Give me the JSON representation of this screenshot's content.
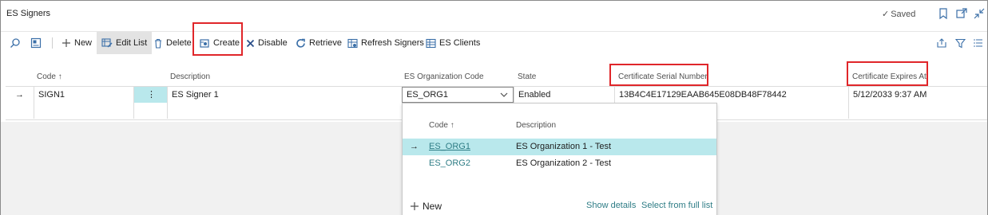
{
  "window": {
    "title": "ES Signers",
    "status": "Saved"
  },
  "actions": {
    "new": "New",
    "edit_list": "Edit List",
    "delete": "Delete",
    "create": "Create",
    "disable": "Disable",
    "retrieve": "Retrieve",
    "refresh_signers": "Refresh Signers",
    "es_clients": "ES Clients"
  },
  "table": {
    "columns": {
      "code": "Code",
      "sort_arrow": "↑",
      "description": "Description",
      "org_code": "ES Organization Code",
      "state": "State",
      "serial": "Certificate Serial Number",
      "expires": "Certificate Expires At"
    },
    "rows": [
      {
        "marker": "→",
        "code": "SIGN1",
        "menu": "⋮",
        "description": "ES Signer 1",
        "org_code": "ES_ORG1",
        "state": "Enabled",
        "serial": "13B4C4E17129EAAB645E08DB48F78442",
        "expires": "5/12/2033 9:37 AM"
      }
    ]
  },
  "lookup": {
    "columns": {
      "code": "Code",
      "sort_arrow": "↑",
      "description": "Description"
    },
    "items": [
      {
        "marker": "→",
        "code": "ES_ORG1",
        "description": "ES Organization 1 - Test"
      },
      {
        "marker": "",
        "code": "ES_ORG2",
        "description": "ES Organization 2 - Test"
      }
    ],
    "new_label": "New",
    "show_details": "Show details",
    "select_full_list": "Select from full list"
  },
  "colors": {
    "accent": "#3b6fa8",
    "link": "#2f7d86",
    "selected_row": "#b9e8ec",
    "highlight_box": "#e0262a"
  }
}
